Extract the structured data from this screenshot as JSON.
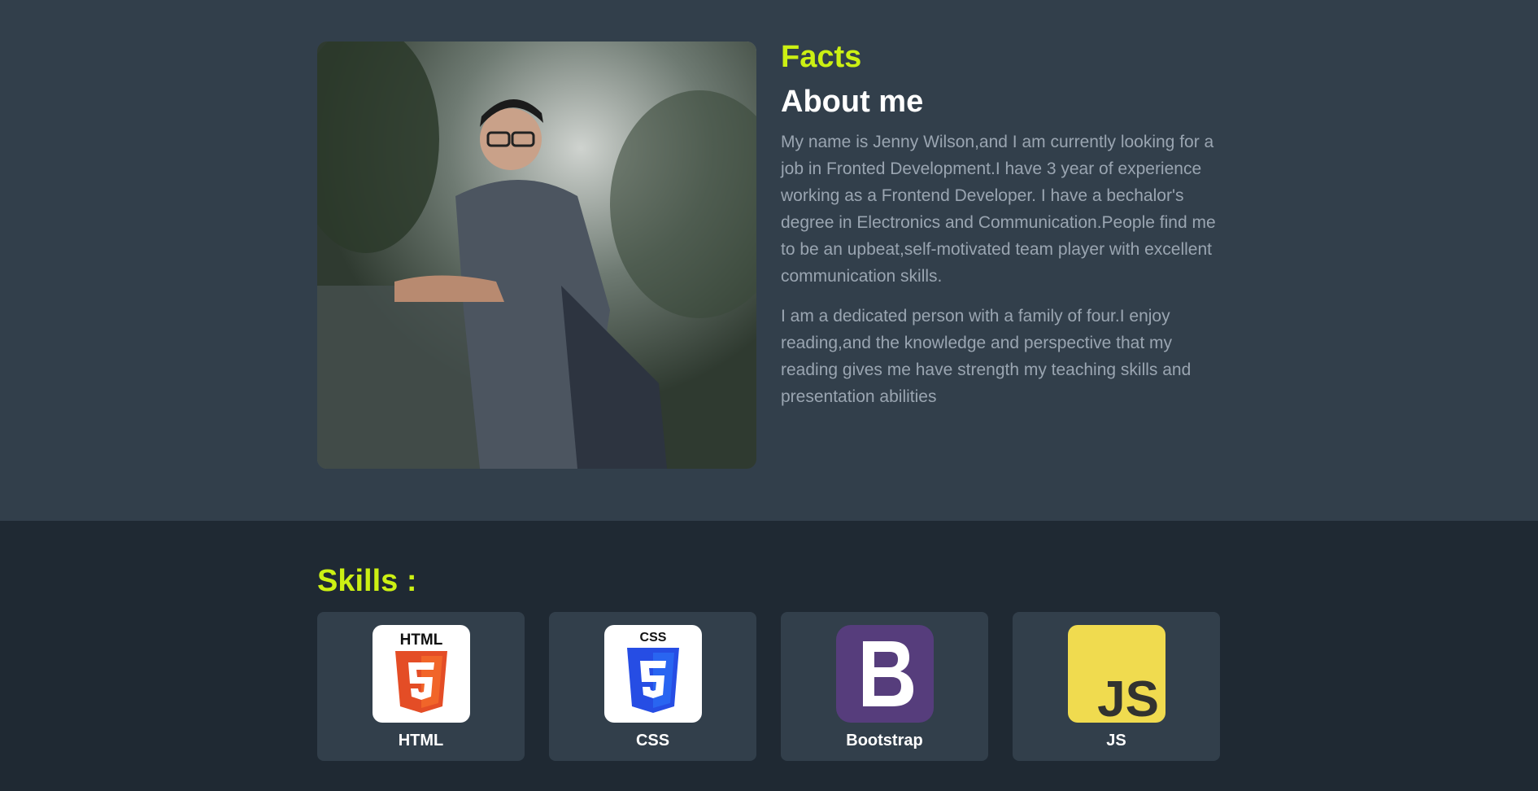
{
  "about": {
    "eyebrow": "Facts",
    "title": "About me",
    "paragraph_1": "My name is Jenny Wilson,and I am currently looking for a job in Fronted Development.I have 3 year of experience working as a Frontend Developer. I have a bechalor's degree in Electronics and Communication.People find me to be an upbeat,self-motivated team player with excellent communication skills.",
    "paragraph_2": "I am a dedicated person with a family of four.I enjoy reading,and the knowledge and perspective that my reading gives me have strength my teaching skills and presentation abilities"
  },
  "skills": {
    "title": "Skills :",
    "items": [
      {
        "label": "HTML",
        "icon": "html5-logo-icon",
        "color": "#e44d26"
      },
      {
        "label": "CSS",
        "icon": "css3-logo-icon",
        "color": "#264de4"
      },
      {
        "label": "Bootstrap",
        "icon": "bootstrap-logo-icon",
        "color": "#563d7c"
      },
      {
        "label": "JS",
        "icon": "javascript-logo-icon",
        "color": "#f0db4f"
      }
    ]
  },
  "colors": {
    "accent": "#ccf013",
    "about_bg": "#323f4b",
    "skills_bg": "#1f2933",
    "body_text": "#9aa5b1"
  }
}
